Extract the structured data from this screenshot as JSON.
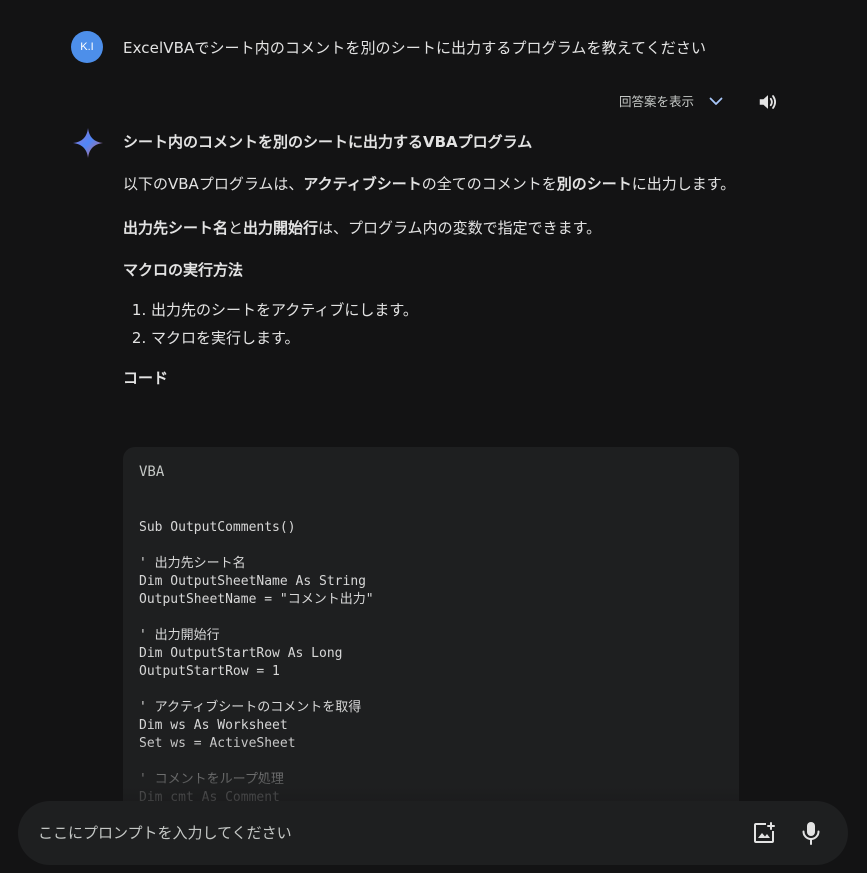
{
  "user": {
    "avatar_initials": "K.I",
    "prompt": "ExcelVBAでシート内のコメントを別のシートに出力するプログラムを教えてください"
  },
  "drafts": {
    "label": "回答案を表示"
  },
  "icons": {
    "avatar": "user-avatar",
    "drafts_toggle": "chevron-down-icon",
    "speaker": "speaker-icon",
    "assistant": "sparkle-icon",
    "add_image": "add-image-icon",
    "mic": "mic-icon"
  },
  "colors": {
    "background": "#131314",
    "surface": "#1e1f20",
    "avatar": "#4d8fea",
    "chevron": "#a8c7fa"
  },
  "response": {
    "heading": "シート内のコメントを別のシートに出力するVBAプログラム",
    "p1": {
      "a": "以下のVBAプログラムは、",
      "b": "アクティブシート",
      "c": "の全てのコメントを",
      "d": "別のシート",
      "e": "に出力します。"
    },
    "p2": {
      "a": "出力先シート名",
      "b": "と",
      "c": "出力開始行",
      "d": "は、プログラム内の変数で指定できます。"
    },
    "run_heading": "マクロの実行方法",
    "steps": [
      "出力先のシートをアクティブにします。",
      "マクロを実行します。"
    ],
    "code_heading": "コード",
    "code": {
      "language": "VBA",
      "lines": [
        "Sub OutputComments()",
        "",
        "' 出力先シート名",
        "Dim OutputSheetName As String",
        "OutputSheetName = \"コメント出力\"",
        "",
        "' 出力開始行",
        "Dim OutputStartRow As Long",
        "OutputStartRow = 1",
        "",
        "' アクティブシートのコメントを取得",
        "Dim ws As Worksheet",
        "Set ws = ActiveSheet",
        "",
        "' コメントをループ処理",
        "Dim cmt As Comment"
      ]
    }
  },
  "input": {
    "placeholder": "ここにプロンプトを入力してください",
    "value": ""
  }
}
